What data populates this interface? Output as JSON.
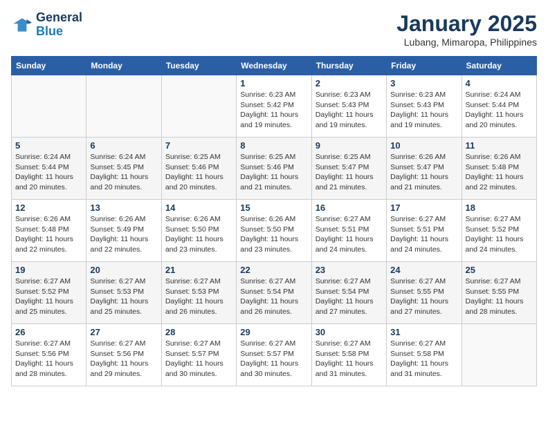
{
  "header": {
    "logo_line1": "General",
    "logo_line2": "Blue",
    "month": "January 2025",
    "location": "Lubang, Mimaropa, Philippines"
  },
  "days_of_week": [
    "Sunday",
    "Monday",
    "Tuesday",
    "Wednesday",
    "Thursday",
    "Friday",
    "Saturday"
  ],
  "weeks": [
    [
      {
        "day": "",
        "info": ""
      },
      {
        "day": "",
        "info": ""
      },
      {
        "day": "",
        "info": ""
      },
      {
        "day": "1",
        "info": "Sunrise: 6:23 AM\nSunset: 5:42 PM\nDaylight: 11 hours\nand 19 minutes."
      },
      {
        "day": "2",
        "info": "Sunrise: 6:23 AM\nSunset: 5:43 PM\nDaylight: 11 hours\nand 19 minutes."
      },
      {
        "day": "3",
        "info": "Sunrise: 6:23 AM\nSunset: 5:43 PM\nDaylight: 11 hours\nand 19 minutes."
      },
      {
        "day": "4",
        "info": "Sunrise: 6:24 AM\nSunset: 5:44 PM\nDaylight: 11 hours\nand 20 minutes."
      }
    ],
    [
      {
        "day": "5",
        "info": "Sunrise: 6:24 AM\nSunset: 5:44 PM\nDaylight: 11 hours\nand 20 minutes."
      },
      {
        "day": "6",
        "info": "Sunrise: 6:24 AM\nSunset: 5:45 PM\nDaylight: 11 hours\nand 20 minutes."
      },
      {
        "day": "7",
        "info": "Sunrise: 6:25 AM\nSunset: 5:46 PM\nDaylight: 11 hours\nand 20 minutes."
      },
      {
        "day": "8",
        "info": "Sunrise: 6:25 AM\nSunset: 5:46 PM\nDaylight: 11 hours\nand 21 minutes."
      },
      {
        "day": "9",
        "info": "Sunrise: 6:25 AM\nSunset: 5:47 PM\nDaylight: 11 hours\nand 21 minutes."
      },
      {
        "day": "10",
        "info": "Sunrise: 6:26 AM\nSunset: 5:47 PM\nDaylight: 11 hours\nand 21 minutes."
      },
      {
        "day": "11",
        "info": "Sunrise: 6:26 AM\nSunset: 5:48 PM\nDaylight: 11 hours\nand 22 minutes."
      }
    ],
    [
      {
        "day": "12",
        "info": "Sunrise: 6:26 AM\nSunset: 5:48 PM\nDaylight: 11 hours\nand 22 minutes."
      },
      {
        "day": "13",
        "info": "Sunrise: 6:26 AM\nSunset: 5:49 PM\nDaylight: 11 hours\nand 22 minutes."
      },
      {
        "day": "14",
        "info": "Sunrise: 6:26 AM\nSunset: 5:50 PM\nDaylight: 11 hours\nand 23 minutes."
      },
      {
        "day": "15",
        "info": "Sunrise: 6:26 AM\nSunset: 5:50 PM\nDaylight: 11 hours\nand 23 minutes."
      },
      {
        "day": "16",
        "info": "Sunrise: 6:27 AM\nSunset: 5:51 PM\nDaylight: 11 hours\nand 24 minutes."
      },
      {
        "day": "17",
        "info": "Sunrise: 6:27 AM\nSunset: 5:51 PM\nDaylight: 11 hours\nand 24 minutes."
      },
      {
        "day": "18",
        "info": "Sunrise: 6:27 AM\nSunset: 5:52 PM\nDaylight: 11 hours\nand 24 minutes."
      }
    ],
    [
      {
        "day": "19",
        "info": "Sunrise: 6:27 AM\nSunset: 5:52 PM\nDaylight: 11 hours\nand 25 minutes."
      },
      {
        "day": "20",
        "info": "Sunrise: 6:27 AM\nSunset: 5:53 PM\nDaylight: 11 hours\nand 25 minutes."
      },
      {
        "day": "21",
        "info": "Sunrise: 6:27 AM\nSunset: 5:53 PM\nDaylight: 11 hours\nand 26 minutes."
      },
      {
        "day": "22",
        "info": "Sunrise: 6:27 AM\nSunset: 5:54 PM\nDaylight: 11 hours\nand 26 minutes."
      },
      {
        "day": "23",
        "info": "Sunrise: 6:27 AM\nSunset: 5:54 PM\nDaylight: 11 hours\nand 27 minutes."
      },
      {
        "day": "24",
        "info": "Sunrise: 6:27 AM\nSunset: 5:55 PM\nDaylight: 11 hours\nand 27 minutes."
      },
      {
        "day": "25",
        "info": "Sunrise: 6:27 AM\nSunset: 5:55 PM\nDaylight: 11 hours\nand 28 minutes."
      }
    ],
    [
      {
        "day": "26",
        "info": "Sunrise: 6:27 AM\nSunset: 5:56 PM\nDaylight: 11 hours\nand 28 minutes."
      },
      {
        "day": "27",
        "info": "Sunrise: 6:27 AM\nSunset: 5:56 PM\nDaylight: 11 hours\nand 29 minutes."
      },
      {
        "day": "28",
        "info": "Sunrise: 6:27 AM\nSunset: 5:57 PM\nDaylight: 11 hours\nand 30 minutes."
      },
      {
        "day": "29",
        "info": "Sunrise: 6:27 AM\nSunset: 5:57 PM\nDaylight: 11 hours\nand 30 minutes."
      },
      {
        "day": "30",
        "info": "Sunrise: 6:27 AM\nSunset: 5:58 PM\nDaylight: 11 hours\nand 31 minutes."
      },
      {
        "day": "31",
        "info": "Sunrise: 6:27 AM\nSunset: 5:58 PM\nDaylight: 11 hours\nand 31 minutes."
      },
      {
        "day": "",
        "info": ""
      }
    ]
  ]
}
